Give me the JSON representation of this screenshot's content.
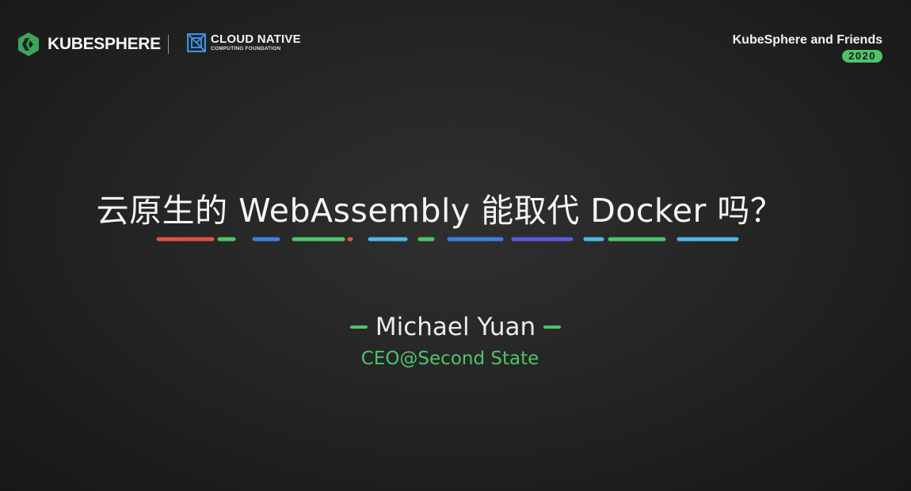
{
  "header": {
    "brand_left": "KUBESPHERE",
    "partner_line1": "CLOUD NATIVE",
    "partner_line2": "COMPUTING FOUNDATION",
    "event_name": "KubeSphere and Friends",
    "event_year": "2020"
  },
  "slide": {
    "title": "云原生的 WebAssembly 能取代 Docker 吗？",
    "speaker": "Michael Yuan",
    "role": "CEO@Second State"
  },
  "colors": {
    "background": "#252525",
    "accent_green": "#4fc36a",
    "text": "#f5f5f5",
    "underline_palette": [
      "#e0533f",
      "#4fc36a",
      "#3f7de0",
      "#4fb6e8",
      "#5a5ad8"
    ]
  },
  "icons": {
    "kubesphere_logo": "kubesphere-logo-icon",
    "cncf_logo": "cncf-logo-icon"
  }
}
